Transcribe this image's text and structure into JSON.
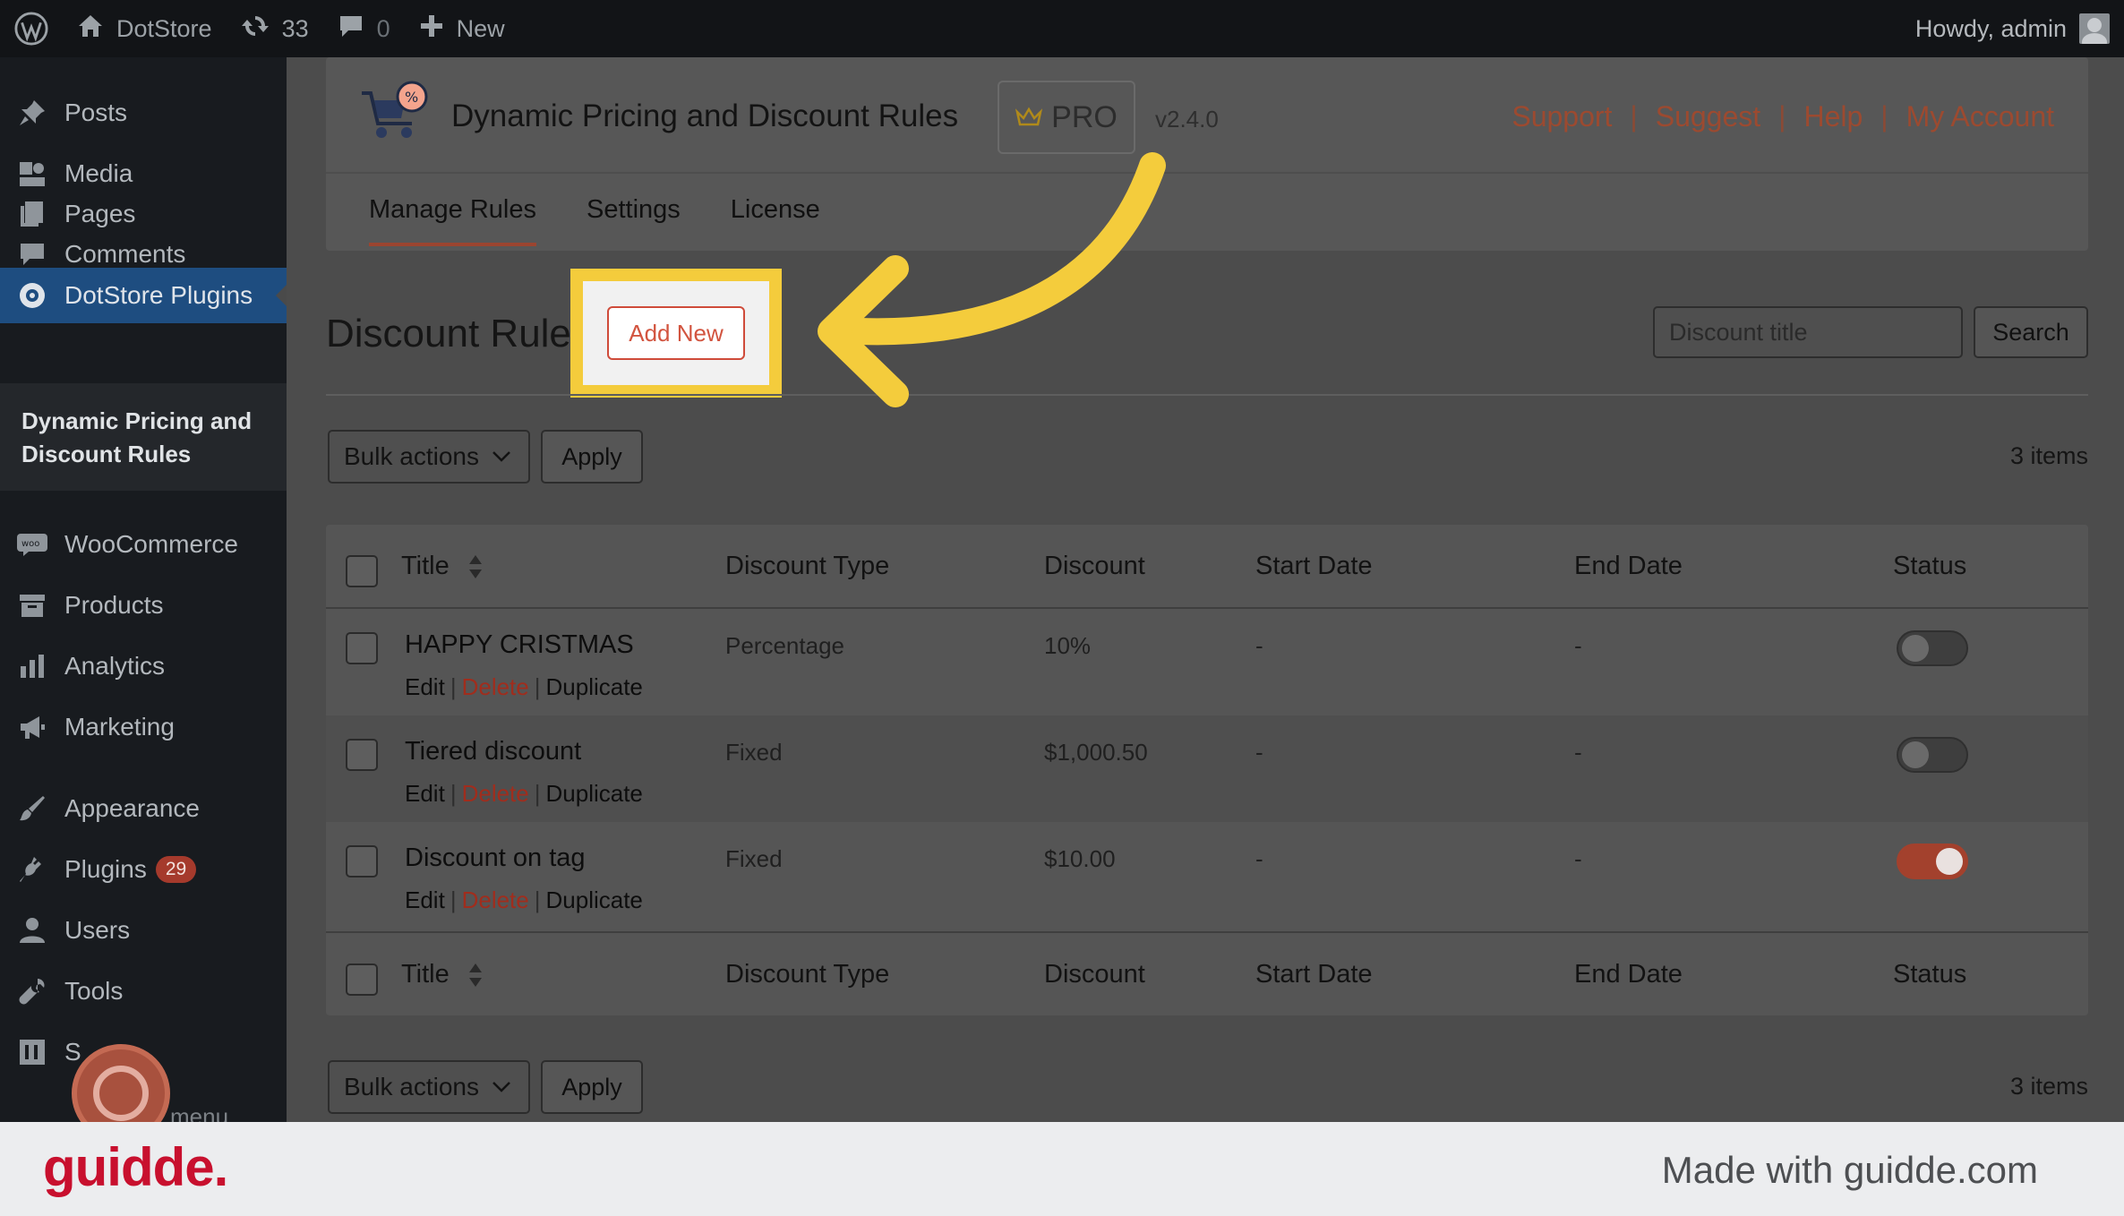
{
  "admin_bar": {
    "site_name": "DotStore",
    "updates_count": "33",
    "comments_count": "0",
    "new_label": "New",
    "greeting": "Howdy, admin"
  },
  "sidebar": {
    "items": [
      {
        "label": "Posts",
        "icon": "pushpin-icon"
      },
      {
        "label": "Media",
        "icon": "media-icon"
      },
      {
        "label": "Pages",
        "icon": "pages-icon"
      },
      {
        "label": "Comments",
        "icon": "comment-icon"
      },
      {
        "label": "DotStore Plugins",
        "icon": "dotstore-icon"
      },
      {
        "label": "WooCommerce",
        "icon": "woo-icon"
      },
      {
        "label": "Products",
        "icon": "archive-icon"
      },
      {
        "label": "Analytics",
        "icon": "bar-chart-icon"
      },
      {
        "label": "Marketing",
        "icon": "megaphone-icon"
      },
      {
        "label": "Appearance",
        "icon": "brush-icon"
      },
      {
        "label": "Plugins",
        "icon": "plugin-icon"
      },
      {
        "label": "Users",
        "icon": "user-icon"
      },
      {
        "label": "Tools",
        "icon": "wrench-icon"
      },
      {
        "label": "S",
        "icon": "settings-icon"
      }
    ],
    "submenu_label": "Dynamic Pricing and Discount Rules",
    "plugins_badge": "29",
    "partial_label": "menu"
  },
  "plugin_header": {
    "title": "Dynamic Pricing and Discount Rules",
    "pro_label": "PRO",
    "version": "v2.4.0",
    "links": [
      "Support",
      "Suggest",
      "Help",
      "My Account"
    ],
    "tabs": [
      "Manage Rules",
      "Settings",
      "License"
    ]
  },
  "page": {
    "title": "Discount Rule",
    "add_new_label": "Add New",
    "search_placeholder": "Discount title",
    "search_label": "Search",
    "bulk_actions_label": "Bulk actions",
    "apply_label": "Apply",
    "items_count": "3 items"
  },
  "table": {
    "columns": [
      "Title",
      "Discount Type",
      "Discount",
      "Start Date",
      "End Date",
      "Status"
    ],
    "rows": [
      {
        "title": "HAPPY CRISTMAS",
        "type": "Percentage",
        "discount": "10%",
        "start": "-",
        "end": "-",
        "enabled": false
      },
      {
        "title": "Tiered discount",
        "type": "Fixed",
        "discount": "$1,000.50",
        "start": "-",
        "end": "-",
        "enabled": false
      },
      {
        "title": "Discount on tag",
        "type": "Fixed",
        "discount": "$10.00",
        "start": "-",
        "end": "-",
        "enabled": true
      }
    ],
    "row_actions": {
      "edit": "Edit",
      "delete": "Delete",
      "duplicate": "Duplicate"
    }
  },
  "footer": {
    "brand": "guidde.",
    "made_with": "Made with guidde.com"
  },
  "colors": {
    "accent": "#f4cc3c",
    "link": "#9c4a30",
    "brand_red": "#c8102e"
  }
}
